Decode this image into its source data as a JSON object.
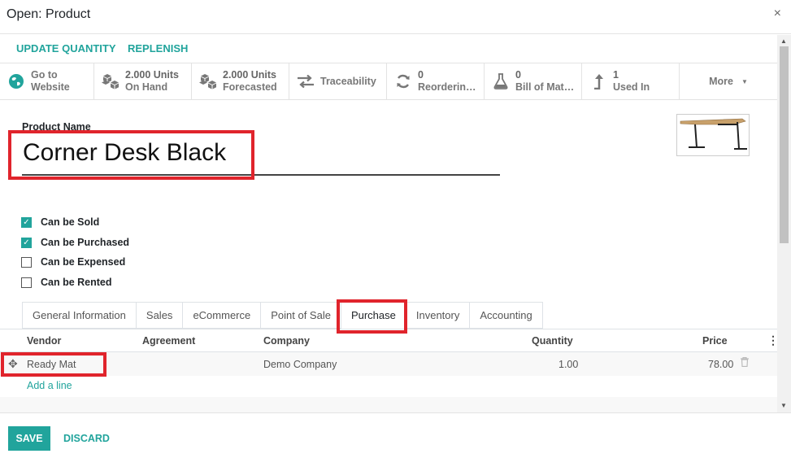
{
  "dialog": {
    "title": "Open: Product",
    "close": "×"
  },
  "header_buttons": {
    "update_quantity": "UPDATE QUANTITY",
    "replenish": "REPLENISH"
  },
  "smart_buttons": [
    {
      "icon": "globe-icon",
      "value": "Go to",
      "label": "Website"
    },
    {
      "icon": "cubes-icon",
      "value": "2.000 Units",
      "label": "On Hand"
    },
    {
      "icon": "cubes-icon",
      "value": "2.000 Units",
      "label": "Forecasted"
    },
    {
      "icon": "exchange-arrows-icon",
      "value": "",
      "label": "Traceability"
    },
    {
      "icon": "refresh-icon",
      "value": "0",
      "label": "Reorderin…"
    },
    {
      "icon": "flask-icon",
      "value": "0",
      "label": "Bill of Mat…"
    },
    {
      "icon": "level-up-icon",
      "value": "1",
      "label": "Used In"
    }
  ],
  "more_label": "More",
  "product": {
    "name_label": "Product Name",
    "name": "Corner Desk Black"
  },
  "checkboxes": [
    {
      "label": "Can be Sold",
      "checked": true
    },
    {
      "label": "Can be Purchased",
      "checked": true
    },
    {
      "label": "Can be Expensed",
      "checked": false
    },
    {
      "label": "Can be Rented",
      "checked": false
    }
  ],
  "tabs": [
    "General Information",
    "Sales",
    "eCommerce",
    "Point of Sale",
    "Purchase",
    "Inventory",
    "Accounting"
  ],
  "active_tab": "Purchase",
  "table": {
    "headers": {
      "vendor": "Vendor",
      "agreement": "Agreement",
      "company": "Company",
      "quantity": "Quantity",
      "price": "Price"
    },
    "rows": [
      {
        "vendor": "Ready Mat",
        "agreement": "",
        "company": "Demo Company",
        "quantity": "1.00",
        "price": "78.00"
      }
    ],
    "add_line": "Add a line"
  },
  "footer": {
    "save": "SAVE",
    "discard": "DISCARD"
  },
  "colors": {
    "accent": "#21a49c",
    "highlight": "#e0242c"
  }
}
